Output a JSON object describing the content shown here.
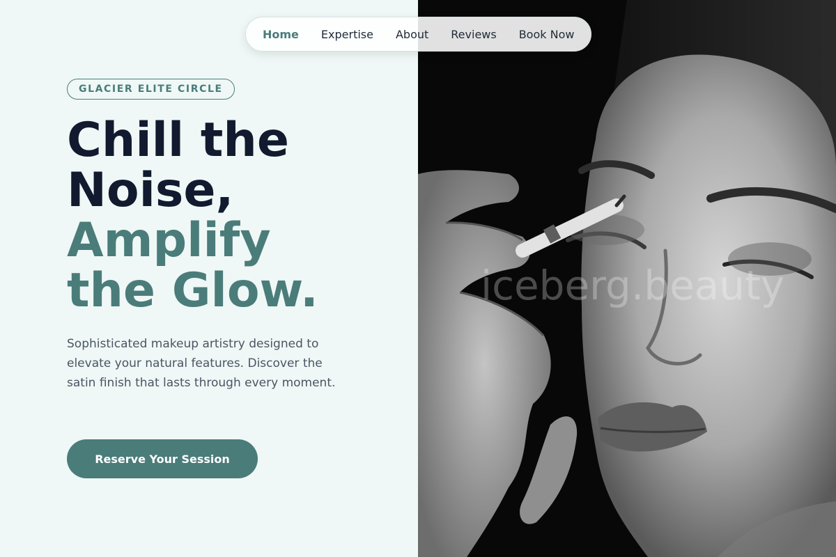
{
  "nav": {
    "items": [
      {
        "label": "Home",
        "active": true
      },
      {
        "label": "Expertise",
        "active": false
      },
      {
        "label": "About",
        "active": false
      },
      {
        "label": "Reviews",
        "active": false
      },
      {
        "label": "Book Now",
        "active": false
      }
    ]
  },
  "hero": {
    "badge": "GLACIER ELITE CIRCLE",
    "headline_dark_1": "Chill the",
    "headline_dark_2": "Noise,",
    "headline_teal_1": "Amplify",
    "headline_teal_2": "the Glow.",
    "description": "Sophisticated makeup artistry designed to elevate your natural features. Discover the satin finish that lasts through every moment.",
    "cta_label": "Reserve Your Session"
  },
  "photo": {
    "watermark": "iceberg.beauty"
  },
  "colors": {
    "accent": "#4a7c7a",
    "heading": "#111a2e",
    "background": "#eff8f6"
  }
}
